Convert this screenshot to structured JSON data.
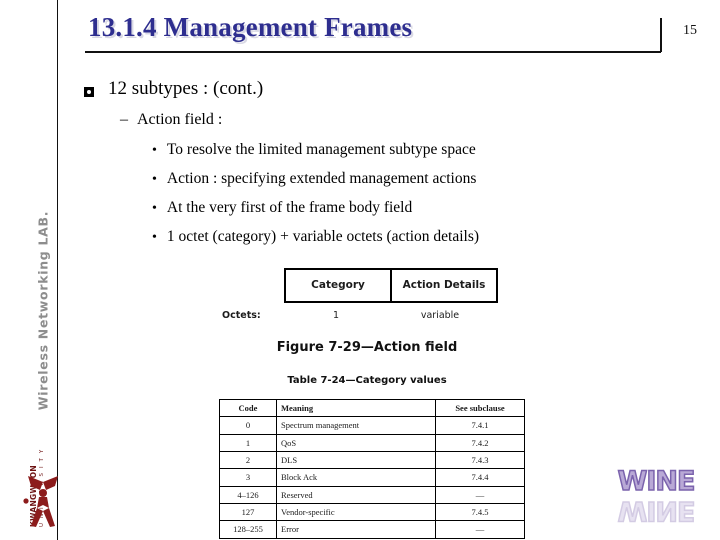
{
  "header": {
    "title": "13.1.4 Management Frames",
    "page_number": "15",
    "title_color": "#2e2e8f"
  },
  "sidebar": {
    "lab_name": "Wireless Networking LAB.",
    "university_line1": "KWANGWOON",
    "university_line2": "U N I V E R S I T Y",
    "logo_color": "#6e1414"
  },
  "content": {
    "level1": {
      "marker": "square-dot-bullet",
      "text": "12 subtypes : (cont.)"
    },
    "level2": {
      "marker": "–",
      "text": "Action field :"
    },
    "level3": {
      "marker": "•",
      "items": [
        "To resolve the limited management subtype space",
        "Action : specifying extended management actions",
        "At the very first of the frame body field",
        "1 octet (category) + variable octets (action details)"
      ]
    }
  },
  "figure": {
    "fields": [
      "Category",
      "Action Details"
    ],
    "octets_label": "Octets:",
    "octets_values": [
      "1",
      "variable"
    ],
    "caption": "Figure 7-29—Action field"
  },
  "table": {
    "caption": "Table 7-24—Category values",
    "columns": [
      "Code",
      "Meaning",
      "See subclause"
    ],
    "rows": [
      [
        "0",
        "Spectrum management",
        "7.4.1"
      ],
      [
        "1",
        "QoS",
        "7.4.2"
      ],
      [
        "2",
        "DLS",
        "7.4.3"
      ],
      [
        "3",
        "Block Ack",
        "7.4.4"
      ],
      [
        "4–126",
        "Reserved",
        "—"
      ],
      [
        "127",
        "Vendor-specific",
        "7.4.5"
      ],
      [
        "128–255",
        "Error",
        "—"
      ]
    ]
  },
  "wine_logo": {
    "text": "WINE",
    "color": "#b9a9d6"
  }
}
